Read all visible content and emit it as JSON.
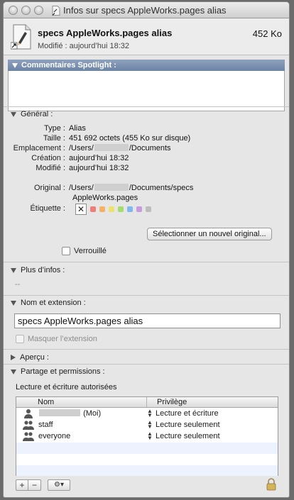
{
  "window": {
    "title": "Infos sur specs AppleWorks.pages alias"
  },
  "header": {
    "file_name": "specs AppleWorks.pages alias",
    "file_size": "452 Ko",
    "modified": "Modifié : aujourd’hui 18:32"
  },
  "spotlight": {
    "label": "Commentaires Spotlight :"
  },
  "general": {
    "label": "Général :",
    "rows": [
      {
        "key": "Type :",
        "value": "Alias"
      },
      {
        "key": "Taille :",
        "value": "451 692 octets (455 Ko sur disque)"
      },
      {
        "key": "Emplacement :",
        "value_prefix": "/Users/",
        "value_suffix": "/Documents"
      },
      {
        "key": "Création :",
        "value": "aujourd’hui 18:32"
      },
      {
        "key": "Modifié :",
        "value": "aujourd’hui 18:32"
      }
    ],
    "original_key": "Original :",
    "original_prefix": "/Users/",
    "original_suffix": "/Documents/specs",
    "original_line2": "AppleWorks.pages",
    "label_key": "Étiquette :",
    "label_none": "✕",
    "label_colors": [
      "#f07d77",
      "#f5b266",
      "#efe26a",
      "#a6dc6e",
      "#7fb7ee",
      "#c99ae0",
      "#bdbdbd"
    ],
    "select_original_button": "Sélectionner un nouvel original...",
    "locked_label": "Verrouillé",
    "locked": false
  },
  "more_info": {
    "label": "Plus d’infos :",
    "value": "--"
  },
  "name_ext": {
    "label": "Nom et extension :",
    "value": "specs AppleWorks.pages alias",
    "hide_ext_label": "Masquer l’extension"
  },
  "preview": {
    "label": "Aperçu :"
  },
  "sharing": {
    "label": "Partage et permissions :",
    "status": "Lecture et écriture autorisées",
    "col_name": "Nom",
    "col_privilege": "Privilège",
    "rows": [
      {
        "name_suffix": "(Moi)",
        "privilege": "Lecture et écriture",
        "icon": "user-icon"
      },
      {
        "name": "staff",
        "privilege": "Lecture seulement",
        "icon": "group-icon"
      },
      {
        "name": "everyone",
        "privilege": "Lecture seulement",
        "icon": "group-icon"
      }
    ],
    "add_label": "+",
    "remove_label": "−",
    "action_label": "⚙▾"
  }
}
